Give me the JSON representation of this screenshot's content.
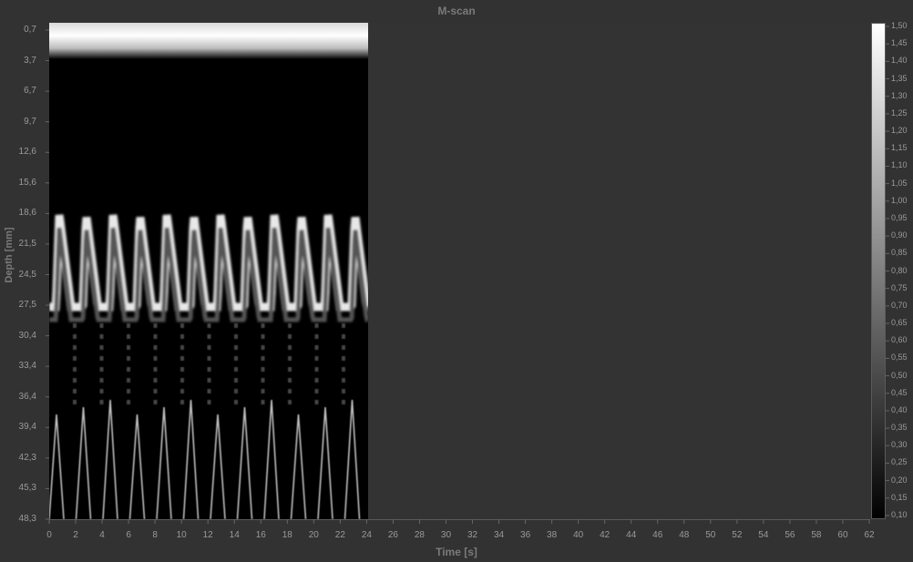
{
  "title": "M-scan",
  "y_axis_label": "Depth [mm]",
  "x_axis_label": "Time [s]",
  "chart_data": {
    "type": "heatmap",
    "title": "M-scan",
    "xlabel": "Time [s]",
    "ylabel": "Depth [mm]",
    "x_ticks": [
      "0",
      "2",
      "4",
      "6",
      "8",
      "10",
      "12",
      "14",
      "16",
      "18",
      "20",
      "22",
      "24",
      "26",
      "28",
      "30",
      "32",
      "34",
      "36",
      "38",
      "40",
      "42",
      "44",
      "46",
      "48",
      "50",
      "52",
      "54",
      "56",
      "58",
      "60",
      "62"
    ],
    "y_ticks": [
      "0,7",
      "3,7",
      "6,7",
      "9,7",
      "12,6",
      "15,6",
      "18,6",
      "21,5",
      "24,5",
      "27,5",
      "30,4",
      "33,4",
      "36,4",
      "39,4",
      "42,3",
      "45,3",
      "48,3"
    ],
    "xlim": [
      0,
      62
    ],
    "ylim": [
      0.7,
      48.3
    ],
    "data_x_range": [
      0,
      24
    ],
    "colorbar_ticks": [
      "1,50",
      "1,45",
      "1,40",
      "1,35",
      "1,30",
      "1,25",
      "1,20",
      "1,15",
      "1,10",
      "1,05",
      "1,00",
      "0,95",
      "0,90",
      "0,85",
      "0,80",
      "0,75",
      "0,70",
      "0,65",
      "0,60",
      "0,55",
      "0,50",
      "0,45",
      "0,40",
      "0,35",
      "0,30",
      "0,25",
      "0,20",
      "0,15",
      "0,10"
    ],
    "colorbar_range": [
      0.1,
      1.5
    ],
    "colormap": "grayscale"
  }
}
